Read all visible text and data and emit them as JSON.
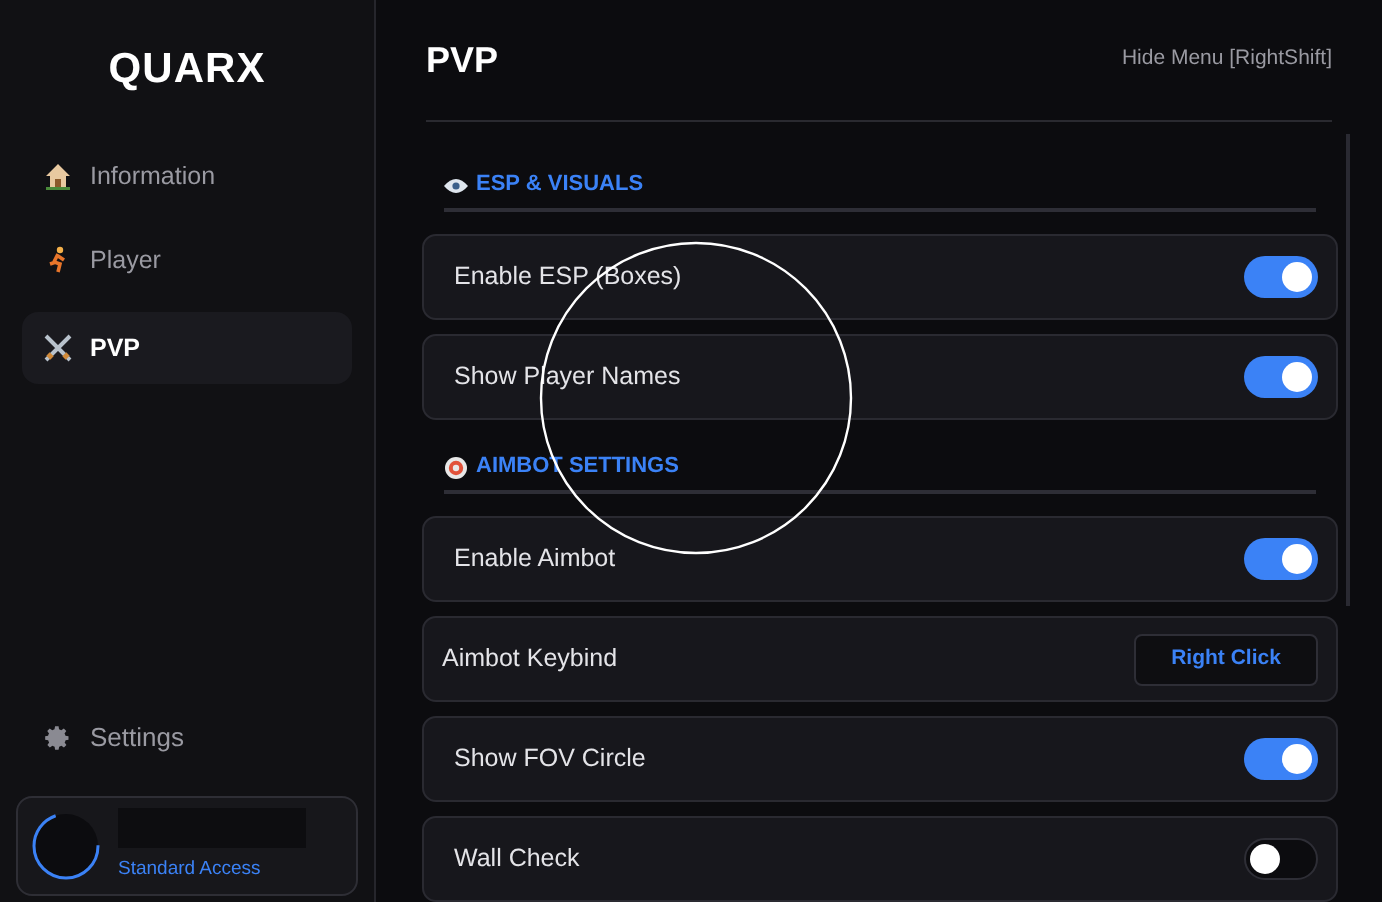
{
  "sidebar": {
    "logo": "QUARX",
    "items": [
      {
        "label": "Information",
        "selected": false
      },
      {
        "label": "Player",
        "selected": false
      },
      {
        "label": "PVP",
        "selected": true
      }
    ],
    "settings": {
      "label": "Settings"
    },
    "profile": {
      "access": "Standard Access"
    }
  },
  "header": {
    "title": "PVP",
    "hint": "Hide Menu [RightShift]"
  },
  "sections": [
    {
      "title": "ESP & VISUALS",
      "rows": [
        {
          "kind": "toggle",
          "label": "Enable ESP (Boxes)",
          "on": true
        },
        {
          "kind": "toggle",
          "label": "Show Player Names",
          "on": true
        }
      ]
    },
    {
      "title": "AIMBOT SETTINGS",
      "rows": [
        {
          "kind": "toggle",
          "label": "Enable Aimbot",
          "on": true
        },
        {
          "kind": "keybind",
          "label": "Aimbot Keybind",
          "value": "Right Click"
        },
        {
          "kind": "toggle",
          "label": "Show FOV Circle",
          "on": true
        },
        {
          "kind": "toggle",
          "label": "Wall Check",
          "on": false
        }
      ]
    }
  ]
}
